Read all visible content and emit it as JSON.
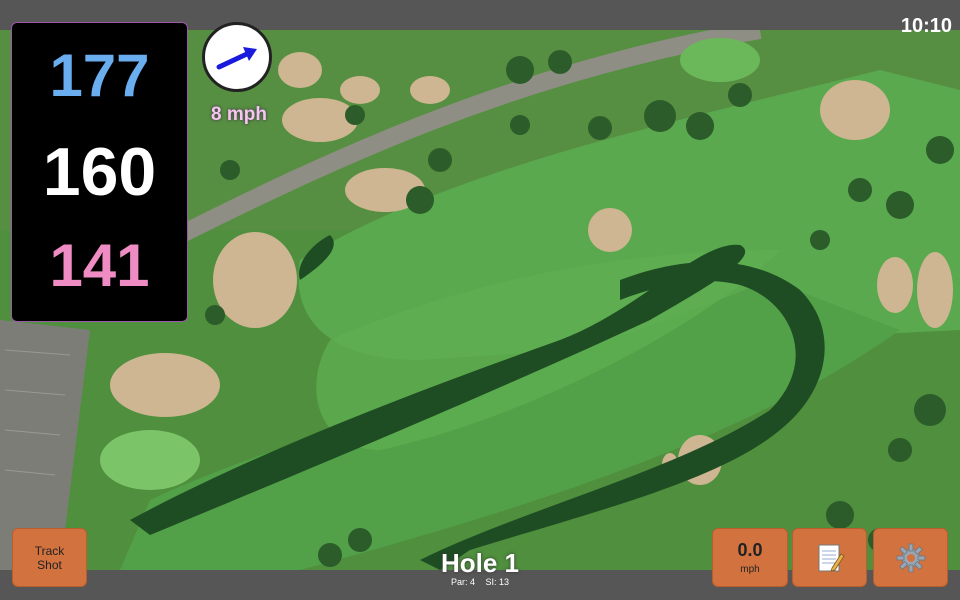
{
  "status_bar": {
    "time": "10:10"
  },
  "yardages": {
    "back": "177",
    "middle": "160",
    "front": "141"
  },
  "wind": {
    "speed_label": "8 mph",
    "direction_icon": "wind-arrow-icon"
  },
  "hole": {
    "title": "Hole 1",
    "par_label": "Par: 4",
    "si_label": "SI: 13"
  },
  "buttons": {
    "track_shot": "Track Shot",
    "speed_value": "0.0",
    "speed_unit": "mph",
    "notes_icon": "notepad-icon",
    "settings_icon": "gear-icon"
  },
  "colors": {
    "back_yardage": "#6aaef0",
    "middle_yardage": "#ffffff",
    "front_yardage": "#f08cc4",
    "button_accent": "#d2723f",
    "wind_arrow": "#1a1adc"
  }
}
